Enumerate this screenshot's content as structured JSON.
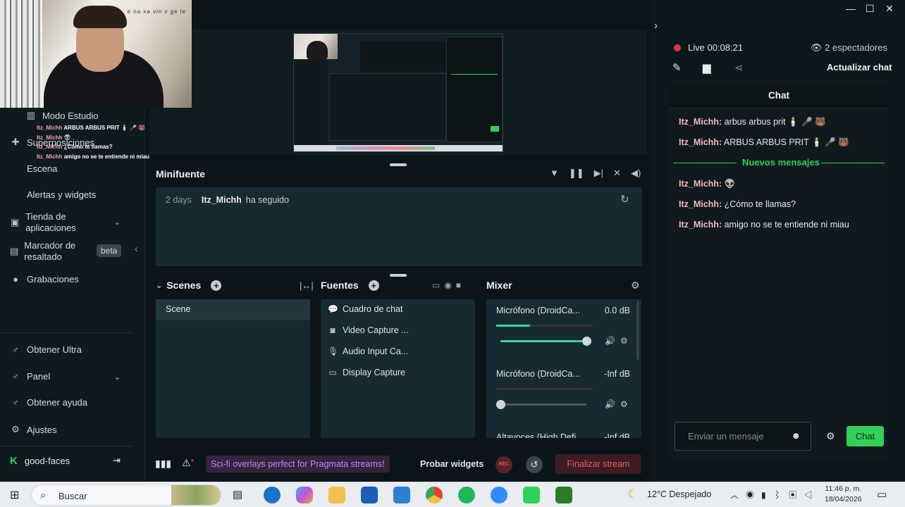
{
  "webcam": {
    "watermark": "e na xa vin v ge le"
  },
  "overlay_chat": [
    {
      "user": "Itz_Michh",
      "text": "ARBUS ARBUS PRIT 🕯️ 🎤 🐻"
    },
    {
      "user": "Itz_Michh",
      "text": "👽"
    },
    {
      "user": "Itz_Michh",
      "text": "¿Cómo te llamas?"
    },
    {
      "user": "Itz_Michh",
      "text": "amigo no se te entiende ni miau"
    }
  ],
  "sidebar": {
    "items": [
      {
        "label": "Modo Estudio"
      },
      {
        "label": "Superposiciones"
      },
      {
        "label": "Escena"
      },
      {
        "label": "Alertas y widgets"
      },
      {
        "label": "Tienda de aplicaciones"
      },
      {
        "label": "Marcador de resaltado",
        "badge": "beta"
      },
      {
        "label": "Grabaciones"
      },
      {
        "label": "Obtener Ultra"
      },
      {
        "label": "Panel"
      },
      {
        "label": "Obtener ayuda"
      },
      {
        "label": "Ajustes"
      }
    ],
    "account": "good-faces"
  },
  "minifuente": {
    "title": "Minifuente",
    "event": {
      "time": "2 days",
      "user": "Itz_Michh",
      "action": "ha seguido"
    }
  },
  "scenes": {
    "title": "Scenes",
    "items": [
      "Scene"
    ]
  },
  "sources": {
    "title": "Fuentes",
    "items": [
      "Cuadro de chat",
      "Video Capture ...",
      "Audio Input Ca...",
      "Display Capture"
    ]
  },
  "mixer": {
    "title": "Mixer",
    "channels": [
      {
        "name": "Micrófono (DroidCa...",
        "db": "0.0 dB",
        "level": 0.35,
        "volume": 1.0
      },
      {
        "name": "Micrófono (DroidCa...",
        "db": "-Inf dB",
        "level": 0.0,
        "volume": 0.0
      },
      {
        "name": "Altavoces (High Defi...",
        "db": "-Inf dB",
        "level": 0.0,
        "volume": 0.0
      }
    ]
  },
  "footer": {
    "promo": "Sci-fi overlays perfect for Pragmata streams!",
    "test_widgets": "Probar widgets",
    "rec": "REC",
    "finalize": "Finalizar stream"
  },
  "live": {
    "status": "Live 00:08:21",
    "viewers": "2 espectadores",
    "refresh_chat": "Actualizar chat"
  },
  "chat": {
    "title": "Chat",
    "messages_before": [
      {
        "user": "Itz_Michh:",
        "text": "arbus arbus prit 🕯️ 🎤 🐻"
      },
      {
        "user": "Itz_Michh:",
        "text": "ARBUS ARBUS PRIT 🕯️ 🎤 🐻"
      }
    ],
    "new_messages_label": "Nuevos mensajes",
    "messages_after": [
      {
        "user": "Itz_Michh:",
        "text": "👽"
      },
      {
        "user": "Itz_Michh:",
        "text": "¿Cómo te llamas?"
      },
      {
        "user": "Itz_Michh:",
        "text": "amigo no se te entiende ni miau"
      }
    ],
    "input_placeholder": "Enviar un mensaje",
    "send_label": "Chat"
  },
  "taskbar": {
    "search": "Buscar",
    "weather": "12°C  Despejado",
    "time": "11:46 p. m.",
    "date": "18/04/2026"
  },
  "colors": {
    "accent": "#31d158",
    "live": "#e0363f",
    "danger": "#f05b66",
    "promo": "#c985f2",
    "mixer_fill": "#35d3a8"
  }
}
